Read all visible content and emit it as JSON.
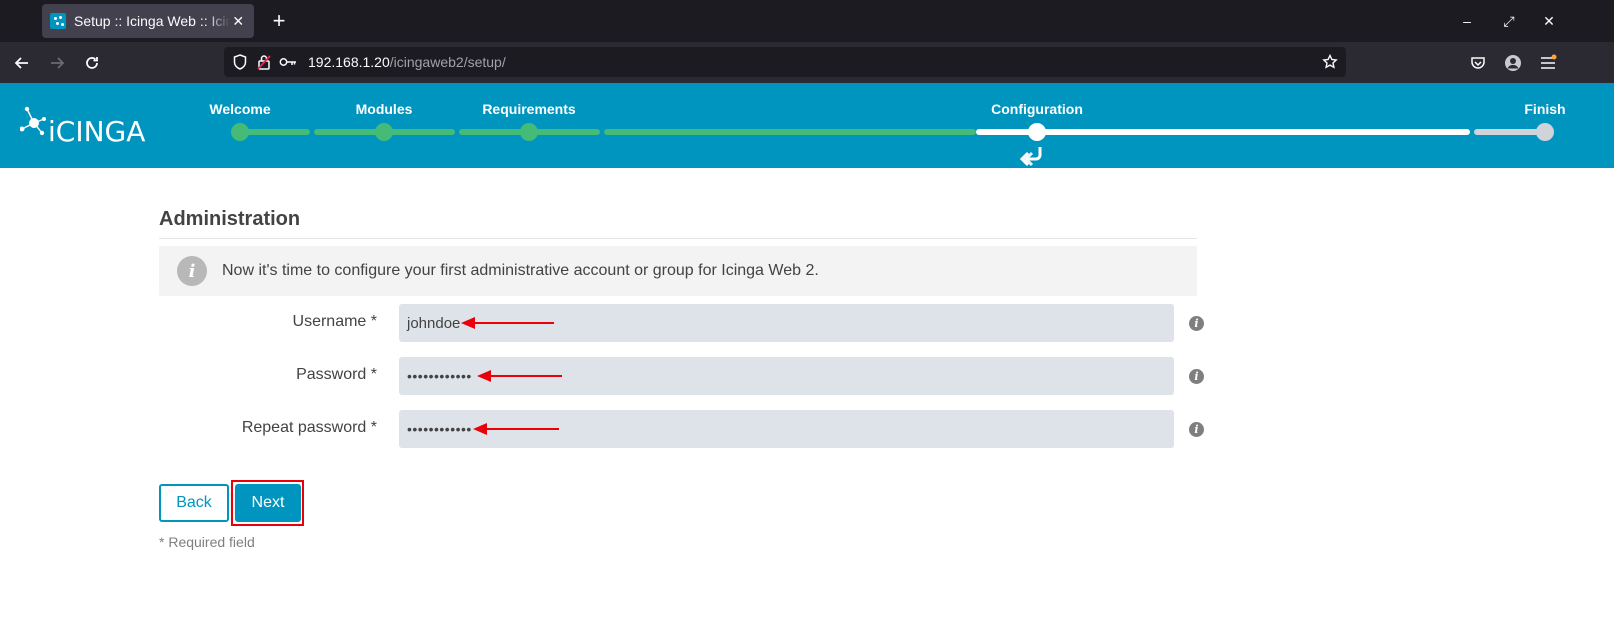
{
  "browser": {
    "tab_title": "Setup :: Icinga Web :: Icinga Web",
    "tab_close": "✕",
    "new_tab": "+",
    "url_host": "192.168.1.20",
    "url_path": "/icingaweb2/setup/",
    "window_controls": {
      "minimize": "–",
      "maximize": "⤢",
      "close": "✕"
    }
  },
  "app": {
    "logo_text": "iCINGA",
    "steps": [
      {
        "label": "Welcome",
        "state": "done"
      },
      {
        "label": "Modules",
        "state": "done"
      },
      {
        "label": "Requirements",
        "state": "done"
      },
      {
        "label": "Configuration",
        "state": "current"
      },
      {
        "label": "Finish",
        "state": "pending"
      }
    ]
  },
  "page": {
    "section_title": "Administration",
    "info_text": "Now it's time to configure your first administrative account or group for Icinga Web 2.",
    "info_icon": "i",
    "fields": {
      "username": {
        "label": "Username *",
        "value": "johndoe"
      },
      "password": {
        "label": "Password *",
        "value": "••••••••••••"
      },
      "repeat_password": {
        "label": "Repeat password *",
        "value": "••••••••••••"
      }
    },
    "help_icon": "i",
    "back_label": "Back",
    "next_label": "Next",
    "required_note": "* Required field"
  },
  "colors": {
    "brand": "#0095bf",
    "progress_done": "#44bb77",
    "annotation": "#e8000b"
  }
}
